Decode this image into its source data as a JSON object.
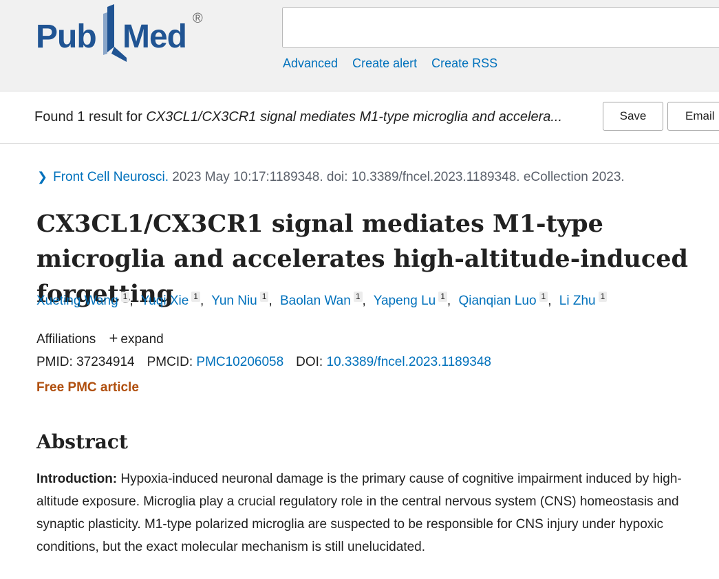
{
  "header": {
    "logo_left": "Pub",
    "logo_right": "Med",
    "logo_reg": "®",
    "search": {
      "value": "",
      "placeholder": ""
    },
    "links": [
      "Advanced",
      "Create alert",
      "Create RSS"
    ]
  },
  "result_bar": {
    "prefix": "Found 1 result for ",
    "query": "CX3CL1/CX3CR1 signal mediates M1-type microglia and accelera...",
    "save_label": "Save",
    "email_label": "Email"
  },
  "article": {
    "journal": "Front Cell Neurosci.",
    "citation_rest": " 2023 May 10:17:1189348. doi: 10.3389/fncel.2023.1189348. eCollection 2023.",
    "title": "CX3CL1/CX3CR1 signal mediates M1-type microglia and accelerates high-altitude-induced forgetting",
    "authors": [
      {
        "name": "Xueting Wang",
        "aff": "1"
      },
      {
        "name": "Yuqi Xie",
        "aff": "1"
      },
      {
        "name": "Yun Niu",
        "aff": "1"
      },
      {
        "name": "Baolan Wan",
        "aff": "1"
      },
      {
        "name": "Yapeng Lu",
        "aff": "1"
      },
      {
        "name": "Qianqian Luo",
        "aff": "1"
      },
      {
        "name": "Li Zhu",
        "aff": "1"
      }
    ],
    "affiliations_label": "Affiliations",
    "expand_label": "expand",
    "pmid_label": "PMID: ",
    "pmid": "37234914",
    "pmcid_label": "PMCID: ",
    "pmcid": "PMC10206058",
    "doi_label": "DOI: ",
    "doi": "10.3389/fncel.2023.1189348",
    "free_pmc": "Free PMC article"
  },
  "abstract": {
    "heading": "Abstract",
    "intro_label": "Introduction:",
    "intro_text": " Hypoxia-induced neuronal damage is the primary cause of cognitive impairment induced by high-altitude exposure. Microglia play a crucial regulatory role in the central nervous system (CNS) homeostasis and synaptic plasticity. M1-type polarized microglia are suspected to be responsible for CNS injury under hypoxic conditions, but the exact molecular mechanism is still unelucidated."
  },
  "colors": {
    "brand": "#205493",
    "link": "#0071bc",
    "free_pmc": "#b04f0e"
  }
}
